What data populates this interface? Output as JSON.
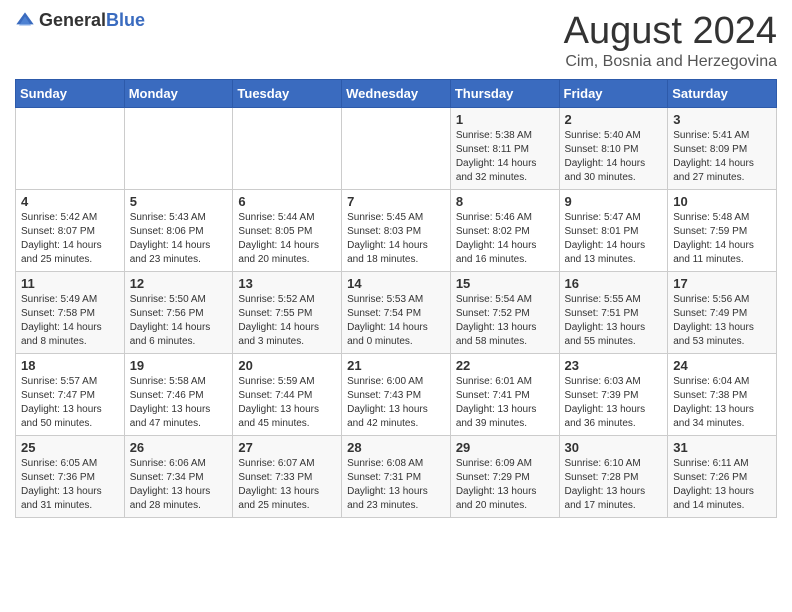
{
  "header": {
    "logo_general": "General",
    "logo_blue": "Blue",
    "month_title": "August 2024",
    "location": "Cim, Bosnia and Herzegovina"
  },
  "days_of_week": [
    "Sunday",
    "Monday",
    "Tuesday",
    "Wednesday",
    "Thursday",
    "Friday",
    "Saturday"
  ],
  "weeks": [
    [
      {
        "day": "",
        "info": ""
      },
      {
        "day": "",
        "info": ""
      },
      {
        "day": "",
        "info": ""
      },
      {
        "day": "",
        "info": ""
      },
      {
        "day": "1",
        "info": "Sunrise: 5:38 AM\nSunset: 8:11 PM\nDaylight: 14 hours\nand 32 minutes."
      },
      {
        "day": "2",
        "info": "Sunrise: 5:40 AM\nSunset: 8:10 PM\nDaylight: 14 hours\nand 30 minutes."
      },
      {
        "day": "3",
        "info": "Sunrise: 5:41 AM\nSunset: 8:09 PM\nDaylight: 14 hours\nand 27 minutes."
      }
    ],
    [
      {
        "day": "4",
        "info": "Sunrise: 5:42 AM\nSunset: 8:07 PM\nDaylight: 14 hours\nand 25 minutes."
      },
      {
        "day": "5",
        "info": "Sunrise: 5:43 AM\nSunset: 8:06 PM\nDaylight: 14 hours\nand 23 minutes."
      },
      {
        "day": "6",
        "info": "Sunrise: 5:44 AM\nSunset: 8:05 PM\nDaylight: 14 hours\nand 20 minutes."
      },
      {
        "day": "7",
        "info": "Sunrise: 5:45 AM\nSunset: 8:03 PM\nDaylight: 14 hours\nand 18 minutes."
      },
      {
        "day": "8",
        "info": "Sunrise: 5:46 AM\nSunset: 8:02 PM\nDaylight: 14 hours\nand 16 minutes."
      },
      {
        "day": "9",
        "info": "Sunrise: 5:47 AM\nSunset: 8:01 PM\nDaylight: 14 hours\nand 13 minutes."
      },
      {
        "day": "10",
        "info": "Sunrise: 5:48 AM\nSunset: 7:59 PM\nDaylight: 14 hours\nand 11 minutes."
      }
    ],
    [
      {
        "day": "11",
        "info": "Sunrise: 5:49 AM\nSunset: 7:58 PM\nDaylight: 14 hours\nand 8 minutes."
      },
      {
        "day": "12",
        "info": "Sunrise: 5:50 AM\nSunset: 7:56 PM\nDaylight: 14 hours\nand 6 minutes."
      },
      {
        "day": "13",
        "info": "Sunrise: 5:52 AM\nSunset: 7:55 PM\nDaylight: 14 hours\nand 3 minutes."
      },
      {
        "day": "14",
        "info": "Sunrise: 5:53 AM\nSunset: 7:54 PM\nDaylight: 14 hours\nand 0 minutes."
      },
      {
        "day": "15",
        "info": "Sunrise: 5:54 AM\nSunset: 7:52 PM\nDaylight: 13 hours\nand 58 minutes."
      },
      {
        "day": "16",
        "info": "Sunrise: 5:55 AM\nSunset: 7:51 PM\nDaylight: 13 hours\nand 55 minutes."
      },
      {
        "day": "17",
        "info": "Sunrise: 5:56 AM\nSunset: 7:49 PM\nDaylight: 13 hours\nand 53 minutes."
      }
    ],
    [
      {
        "day": "18",
        "info": "Sunrise: 5:57 AM\nSunset: 7:47 PM\nDaylight: 13 hours\nand 50 minutes."
      },
      {
        "day": "19",
        "info": "Sunrise: 5:58 AM\nSunset: 7:46 PM\nDaylight: 13 hours\nand 47 minutes."
      },
      {
        "day": "20",
        "info": "Sunrise: 5:59 AM\nSunset: 7:44 PM\nDaylight: 13 hours\nand 45 minutes."
      },
      {
        "day": "21",
        "info": "Sunrise: 6:00 AM\nSunset: 7:43 PM\nDaylight: 13 hours\nand 42 minutes."
      },
      {
        "day": "22",
        "info": "Sunrise: 6:01 AM\nSunset: 7:41 PM\nDaylight: 13 hours\nand 39 minutes."
      },
      {
        "day": "23",
        "info": "Sunrise: 6:03 AM\nSunset: 7:39 PM\nDaylight: 13 hours\nand 36 minutes."
      },
      {
        "day": "24",
        "info": "Sunrise: 6:04 AM\nSunset: 7:38 PM\nDaylight: 13 hours\nand 34 minutes."
      }
    ],
    [
      {
        "day": "25",
        "info": "Sunrise: 6:05 AM\nSunset: 7:36 PM\nDaylight: 13 hours\nand 31 minutes."
      },
      {
        "day": "26",
        "info": "Sunrise: 6:06 AM\nSunset: 7:34 PM\nDaylight: 13 hours\nand 28 minutes."
      },
      {
        "day": "27",
        "info": "Sunrise: 6:07 AM\nSunset: 7:33 PM\nDaylight: 13 hours\nand 25 minutes."
      },
      {
        "day": "28",
        "info": "Sunrise: 6:08 AM\nSunset: 7:31 PM\nDaylight: 13 hours\nand 23 minutes."
      },
      {
        "day": "29",
        "info": "Sunrise: 6:09 AM\nSunset: 7:29 PM\nDaylight: 13 hours\nand 20 minutes."
      },
      {
        "day": "30",
        "info": "Sunrise: 6:10 AM\nSunset: 7:28 PM\nDaylight: 13 hours\nand 17 minutes."
      },
      {
        "day": "31",
        "info": "Sunrise: 6:11 AM\nSunset: 7:26 PM\nDaylight: 13 hours\nand 14 minutes."
      }
    ]
  ]
}
